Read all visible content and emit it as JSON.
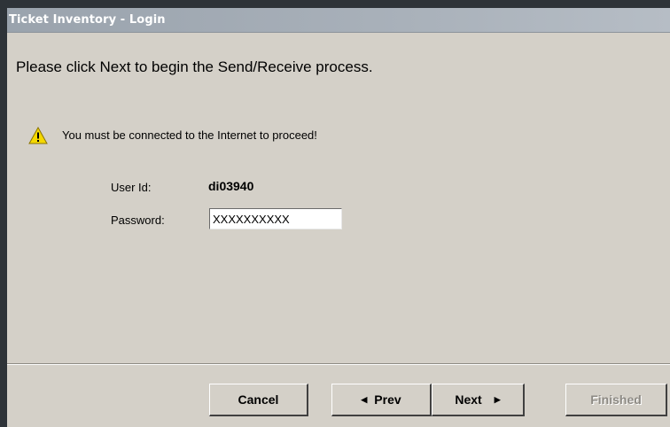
{
  "window": {
    "title": "Ticket Inventory - Login"
  },
  "main": {
    "instruction": "Please click Next to begin the Send/Receive process.",
    "warning": {
      "icon": "warning-icon",
      "text": "You must be connected to the Internet to proceed!"
    },
    "user_id": {
      "label": "User Id:",
      "value": "di03940"
    },
    "password": {
      "label": "Password:",
      "value": "XXXXXXXXXX"
    }
  },
  "buttons": {
    "cancel": "Cancel",
    "prev": "Prev",
    "next": "Next",
    "finished": "Finished"
  },
  "colors": {
    "window_bg": "#d4d0c8",
    "warning_yellow": "#f5d800"
  }
}
